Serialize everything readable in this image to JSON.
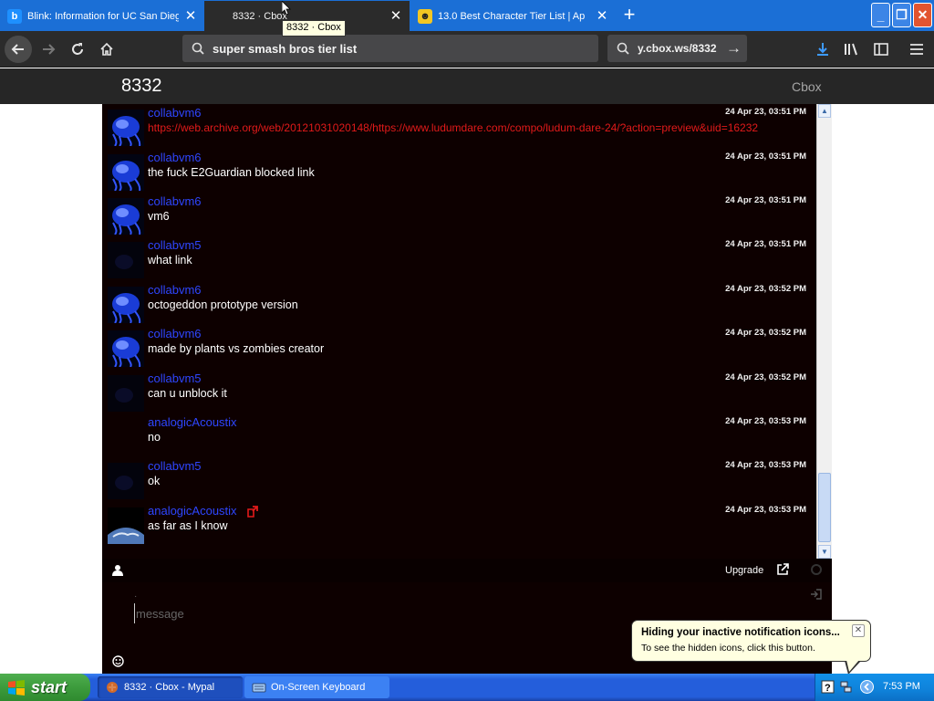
{
  "browser": {
    "tabs": [
      {
        "title": "Blink: Information for UC San Diego",
        "icon": "blink-favicon",
        "active": false
      },
      {
        "title": "8332 · Cbox",
        "icon": "cbox-favicon",
        "active": true
      },
      {
        "title": "13.0 Best Character Tier List | Ap",
        "icon": "game-favicon",
        "active": false
      }
    ],
    "tooltip": "8332 · Cbox",
    "address_bar": "super smash bros tier list",
    "search_bar": "y.cbox.ws/8332"
  },
  "page": {
    "title": "8332",
    "brand": "Cbox"
  },
  "chat": {
    "messages": [
      {
        "user": "collabvm6",
        "time": "24 Apr 23, 03:51 PM",
        "text": "https://web.archive.org/web/20121031020148/https://www.ludumdare.com/compo/ludum-dare-24/?action=preview&uid=16232",
        "is_link": true,
        "avatar": "blue"
      },
      {
        "user": "collabvm6",
        "time": "24 Apr 23, 03:51 PM",
        "text": "the fuck E2Guardian blocked link",
        "is_link": false,
        "avatar": "blue"
      },
      {
        "user": "collabvm6",
        "time": "24 Apr 23, 03:51 PM",
        "text": "vm6",
        "is_link": false,
        "avatar": "blue"
      },
      {
        "user": "collabvm5",
        "time": "24 Apr 23, 03:51 PM",
        "text": "what link",
        "is_link": false,
        "avatar": "dark"
      },
      {
        "user": "collabvm6",
        "time": "24 Apr 23, 03:52 PM",
        "text": "octogeddon prototype version",
        "is_link": false,
        "avatar": "blue"
      },
      {
        "user": "collabvm6",
        "time": "24 Apr 23, 03:52 PM",
        "text": "made by plants vs zombies creator",
        "is_link": false,
        "avatar": "blue"
      },
      {
        "user": "collabvm5",
        "time": "24 Apr 23, 03:52 PM",
        "text": "can u unblock it",
        "is_link": false,
        "avatar": "dark"
      },
      {
        "user": "analogicAcoustix",
        "time": "24 Apr 23, 03:53 PM",
        "text": "no",
        "is_link": false,
        "avatar": "none"
      },
      {
        "user": "collabvm5",
        "time": "24 Apr 23, 03:53 PM",
        "text": "ok",
        "is_link": false,
        "avatar": "dark"
      },
      {
        "user": "analogicAcoustix",
        "time": "24 Apr 23, 03:53 PM",
        "text": "as far as I know",
        "is_link": false,
        "avatar": "earth"
      }
    ],
    "toolbar": {
      "upgrade_label": "Upgrade"
    },
    "compose": {
      "name_value": "·",
      "placeholder": "message"
    }
  },
  "notification": {
    "title": "Hiding your inactive notification icons...",
    "body": "To see the hidden icons, click this button."
  },
  "taskbar": {
    "start_label": "start",
    "tasks": [
      {
        "label": "8332 · Cbox - Mypal",
        "active": true
      },
      {
        "label": "On-Screen Keyboard",
        "active": false
      }
    ],
    "clock": "7:53 PM"
  },
  "colors": {
    "tabstrip": "#1b6fd6",
    "chat_background": "#0d0000",
    "username": "#2e46ff",
    "link_text": "#e11a1a",
    "taskbar": "#245edb"
  }
}
